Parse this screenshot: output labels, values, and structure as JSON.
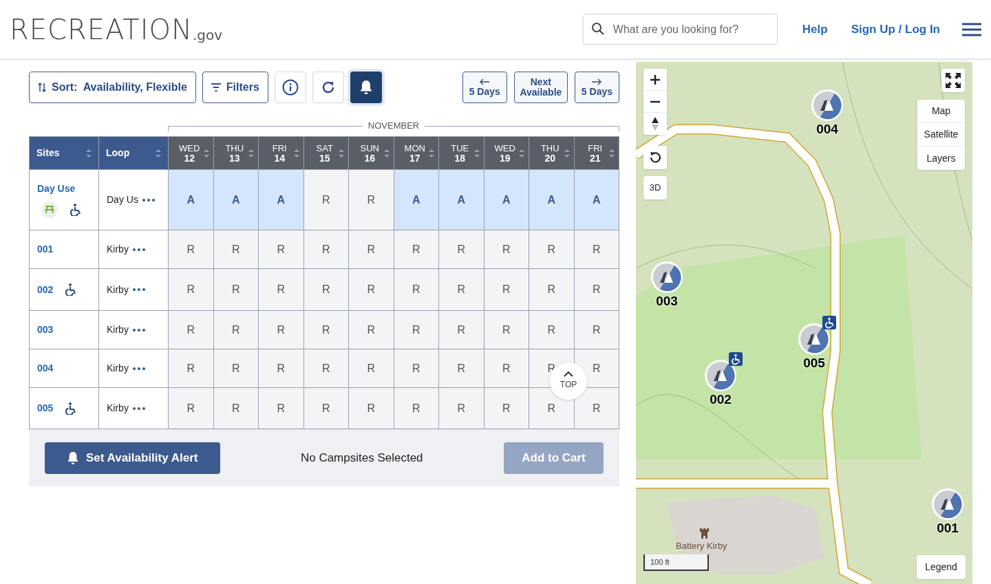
{
  "header": {
    "logo": {
      "text": "RECREATION",
      "suffix": ".gov"
    },
    "search": {
      "placeholder": "What are you looking for?"
    },
    "links": [
      "Help",
      "Sign Up / Log In"
    ]
  },
  "toolbar": {
    "sort": "Sort:  Availability, Flexible",
    "filters": "Filters",
    "alert_selected": true,
    "nav": [
      {
        "kind": "prev",
        "label": "5 Days"
      },
      {
        "kind": "next_available",
        "label": "Next Available"
      },
      {
        "kind": "next",
        "label": "5 Days"
      }
    ]
  },
  "month": "NOVEMBER",
  "columns": [
    "Sites",
    "Loop"
  ],
  "days": [
    {
      "dow": "WED",
      "day": "12"
    },
    {
      "dow": "THU",
      "day": "13"
    },
    {
      "dow": "FRI",
      "day": "14"
    },
    {
      "dow": "SAT",
      "day": "15"
    },
    {
      "dow": "SUN",
      "day": "16"
    },
    {
      "dow": "MON",
      "day": "17"
    },
    {
      "dow": "TUE",
      "day": "18"
    },
    {
      "dow": "WED",
      "day": "19"
    },
    {
      "dow": "THU",
      "day": "20"
    },
    {
      "dow": "FRI",
      "day": "21"
    }
  ],
  "rows": [
    {
      "site": "Day Use",
      "picnic": true,
      "accessible": true,
      "loop": "Day Us",
      "cells": [
        {
          "text": "A",
          "available": true
        },
        {
          "text": "A",
          "available": true
        },
        {
          "text": "A",
          "available": true
        },
        {
          "text": "R",
          "available": false
        },
        {
          "text": "R",
          "available": false
        },
        {
          "text": "A",
          "available": true
        },
        {
          "text": "A",
          "available": true
        },
        {
          "text": "A",
          "available": true
        },
        {
          "text": "A",
          "available": true
        },
        {
          "text": "A",
          "available": true
        }
      ]
    },
    {
      "site": "001",
      "accessible": false,
      "loop": "Kirby",
      "cells": [
        {
          "text": "R",
          "available": false
        },
        {
          "text": "R",
          "available": false
        },
        {
          "text": "R",
          "available": false
        },
        {
          "text": "R",
          "available": false
        },
        {
          "text": "R",
          "available": false
        },
        {
          "text": "R",
          "available": false
        },
        {
          "text": "R",
          "available": false
        },
        {
          "text": "R",
          "available": false
        },
        {
          "text": "R",
          "available": false
        },
        {
          "text": "R",
          "available": false
        }
      ]
    },
    {
      "site": "002",
      "accessible": true,
      "loop": "Kirby",
      "cells": [
        {
          "text": "R",
          "available": false
        },
        {
          "text": "R",
          "available": false
        },
        {
          "text": "R",
          "available": false
        },
        {
          "text": "R",
          "available": false
        },
        {
          "text": "R",
          "available": false
        },
        {
          "text": "R",
          "available": false
        },
        {
          "text": "R",
          "available": false
        },
        {
          "text": "R",
          "available": false
        },
        {
          "text": "R",
          "available": false
        },
        {
          "text": "R",
          "available": false
        }
      ]
    },
    {
      "site": "003",
      "accessible": false,
      "loop": "Kirby",
      "cells": [
        {
          "text": "R",
          "available": false
        },
        {
          "text": "R",
          "available": false
        },
        {
          "text": "R",
          "available": false
        },
        {
          "text": "R",
          "available": false
        },
        {
          "text": "R",
          "available": false
        },
        {
          "text": "R",
          "available": false
        },
        {
          "text": "R",
          "available": false
        },
        {
          "text": "R",
          "available": false
        },
        {
          "text": "R",
          "available": false
        },
        {
          "text": "R",
          "available": false
        }
      ]
    },
    {
      "site": "004",
      "accessible": false,
      "loop": "Kirby",
      "cells": [
        {
          "text": "R",
          "available": false
        },
        {
          "text": "R",
          "available": false
        },
        {
          "text": "R",
          "available": false
        },
        {
          "text": "R",
          "available": false
        },
        {
          "text": "R",
          "available": false
        },
        {
          "text": "R",
          "available": false
        },
        {
          "text": "R",
          "available": false
        },
        {
          "text": "R",
          "available": false
        },
        {
          "text": "R",
          "available": false
        },
        {
          "text": "R",
          "available": false
        }
      ]
    },
    {
      "site": "005",
      "accessible": true,
      "loop": "Kirby",
      "cells": [
        {
          "text": "R",
          "available": false
        },
        {
          "text": "R",
          "available": false
        },
        {
          "text": "R",
          "available": false
        },
        {
          "text": "R",
          "available": false
        },
        {
          "text": "R",
          "available": false
        },
        {
          "text": "R",
          "available": false
        },
        {
          "text": "R",
          "available": false
        },
        {
          "text": "R",
          "available": false
        },
        {
          "text": "R",
          "available": false
        },
        {
          "text": "R",
          "available": false
        }
      ]
    }
  ],
  "top_button": "TOP",
  "footer": {
    "alert_button": "Set Availability Alert",
    "status": "No Campsites Selected",
    "cart_button": "Add to Cart",
    "cart_disabled": true
  },
  "map": {
    "three_d": "3D",
    "map_types": [
      "Map",
      "Satellite",
      "Layers"
    ],
    "markers": [
      {
        "label": "004",
        "accessible": false
      },
      {
        "label": "003",
        "accessible": false
      },
      {
        "label": "005",
        "accessible": true
      },
      {
        "label": "002",
        "accessible": true
      },
      {
        "label": "001",
        "accessible": false
      }
    ],
    "place": "Battery Kirby",
    "scale": "100 ft",
    "legend": "Legend"
  }
}
